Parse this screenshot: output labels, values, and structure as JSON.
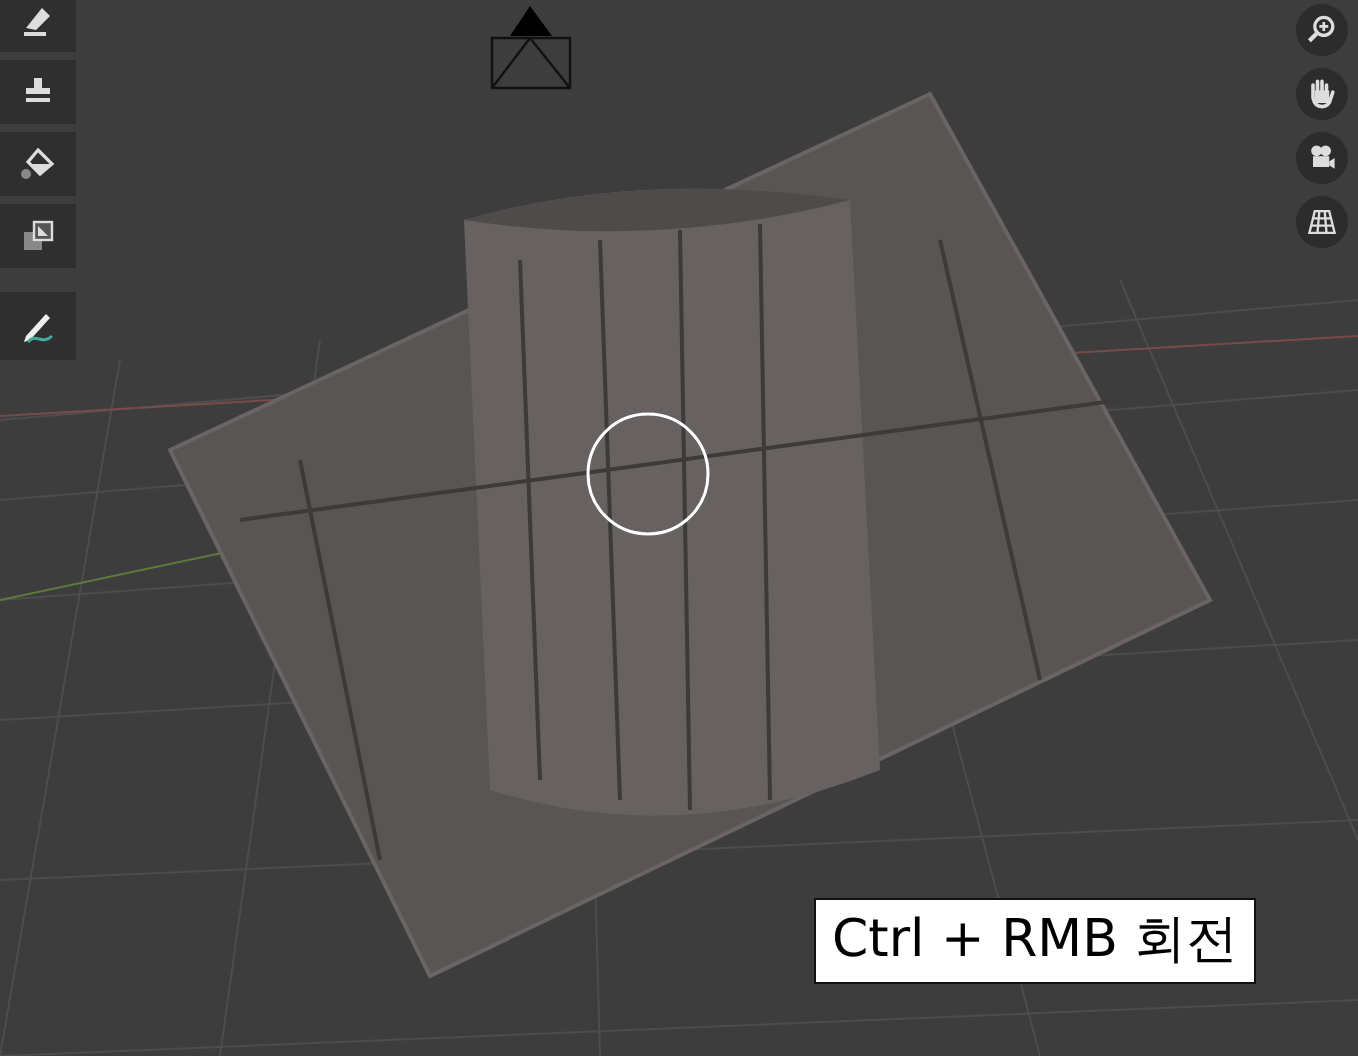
{
  "tools": [
    {
      "kind": "smear"
    },
    {
      "kind": "stamp"
    },
    {
      "kind": "fill"
    },
    {
      "kind": "mask"
    },
    {
      "kind": "annotate"
    }
  ],
  "navigation": [
    {
      "kind": "zoom"
    },
    {
      "kind": "pan"
    },
    {
      "kind": "camera"
    },
    {
      "kind": "grid"
    }
  ],
  "hint": {
    "text": "Ctrl + RMB 회전"
  }
}
